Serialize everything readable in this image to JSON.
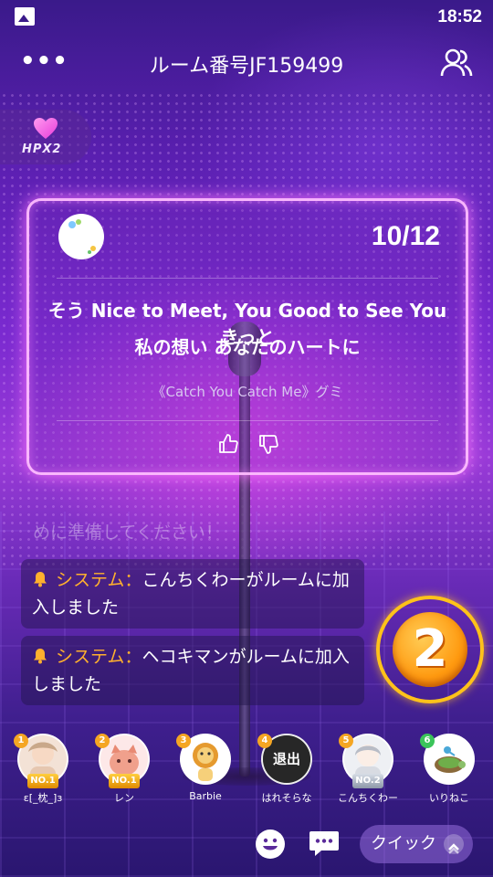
{
  "status_bar": {
    "time": "18:52",
    "icon": "gallery-icon"
  },
  "header": {
    "more_label": "•••",
    "title": "ルーム番号JF159499",
    "users_icon": "users-icon"
  },
  "badge": {
    "label": "HPX2",
    "icon": "heart-icon"
  },
  "lyric_card": {
    "counter": "10/12",
    "line1": "そう Nice to Meet, You Good to See You きっと",
    "line2": "私の想い あなたのハートに",
    "song_info": "《Catch You Catch Me》グミ"
  },
  "chat": {
    "faded_text": "めに準備してください！",
    "messages": [
      {
        "label": "システム：",
        "text": "こんちくわーがルームに加入しました"
      },
      {
        "label": "システム：",
        "text": "ヘコキマンがルームに加入しました"
      }
    ]
  },
  "score_button": {
    "glyph": "2"
  },
  "seats": [
    {
      "num": "1",
      "rank": "NO.1",
      "name": "ε[_枕_]з"
    },
    {
      "num": "2",
      "rank": "NO.1",
      "name": "レン"
    },
    {
      "num": "3",
      "rank": "",
      "name": "Barbie"
    },
    {
      "num": "4",
      "rank": "",
      "name": "はれそらな",
      "status": "退出"
    },
    {
      "num": "5",
      "rank": "NO.2",
      "name": "こんちくわー"
    },
    {
      "num": "6",
      "rank": "",
      "name": "いりねこ"
    }
  ],
  "bottom_bar": {
    "quick_label": "クイック"
  },
  "colors": {
    "accent_orange": "#ffb02e",
    "card_glow": "#ff78ff",
    "score_gold": "#ffc21a"
  }
}
